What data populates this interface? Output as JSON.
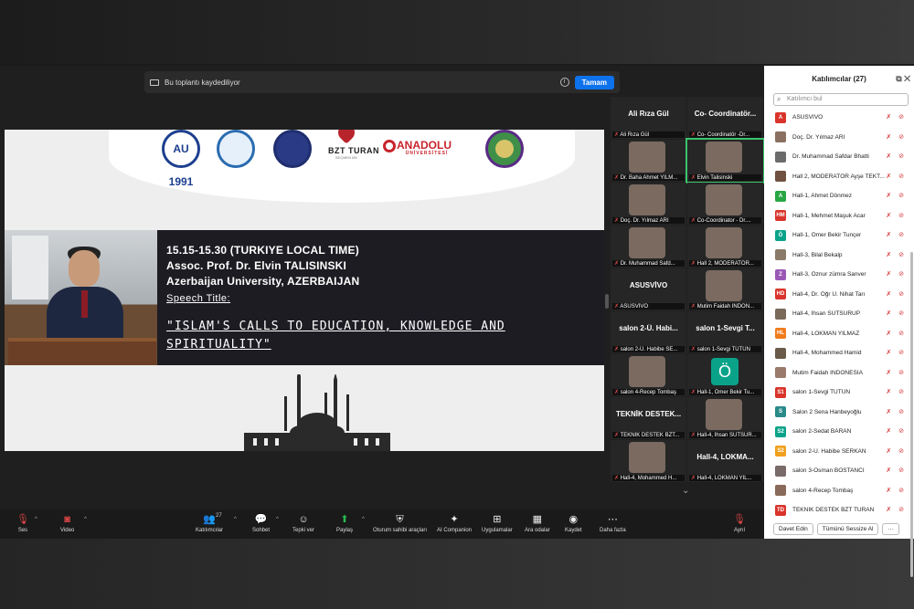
{
  "recording_bar": {
    "text": "Bu toplantı kaydediliyor",
    "ok_label": "Tamam"
  },
  "slide": {
    "logos": [
      "AU",
      "BARTIN ÜNİVERSİTESİ",
      "",
      "BZT TURAN",
      "ANADOLU ÜNİVERSİTESİ",
      ""
    ],
    "logo_ttext": {
      "au": "AU 1991",
      "bzt": "BZT TURAN",
      "bzt_sub": "SEÇMEN MV",
      "anadolu": "ANADOLU",
      "anadolu_sub": "ÜNİVERSİTESİ"
    },
    "time": "15.15-15.30 (TURKIYE LOCAL TIME)",
    "speaker": "Assoc. Prof. Dr. Elvin TALISINSKI",
    "affiliation": "Azerbaijan University, AZERBAIJAN",
    "speech_label": "Speech Title:",
    "speech_title_1": "\"ISLAM'S CALLS TO EDUCATION, KNOWLEDGE AND",
    "speech_title_2": "SPIRITUALITY\""
  },
  "grid": {
    "tiles": [
      {
        "name": "Ali Rıza Gül",
        "label": "Ali Rıza Gül",
        "kind": "name"
      },
      {
        "name": "Co- Coordinatör...",
        "label": "Co- Coordinatör -Dr...",
        "kind": "name"
      },
      {
        "name": "",
        "label": "Dr. Baha Ahmet YILM...",
        "kind": "pic"
      },
      {
        "name": "",
        "label": "Elvin Talisinski",
        "kind": "pic",
        "active": true
      },
      {
        "name": "",
        "label": "Doç. Dr. Yılmaz ARI",
        "kind": "pic"
      },
      {
        "name": "",
        "label": "Co-Coordinator - Dr....",
        "kind": "pic"
      },
      {
        "name": "",
        "label": "Dr. Muhammad Safd...",
        "kind": "pic"
      },
      {
        "name": "",
        "label": "Hall 2, MODERATÖR...",
        "kind": "pic"
      },
      {
        "name": "ASUSVİVO",
        "label": "ASUSVİVO",
        "kind": "name"
      },
      {
        "name": "",
        "label": "Mutim Faidah INDON...",
        "kind": "pic"
      },
      {
        "name": "salon 2-Ü. Habi...",
        "label": "salon 2-Ü. Habibe SE...",
        "kind": "name"
      },
      {
        "name": "salon 1-Sevgi T...",
        "label": "salon 1-Sevgi TÜTÜN",
        "kind": "name"
      },
      {
        "name": "",
        "label": "salon 4-Recep Tombaş",
        "kind": "pic"
      },
      {
        "name": "",
        "label": "Hall-1, Ömer Bekir Tu...",
        "kind": "avatar",
        "letter": "Ö"
      },
      {
        "name": "TEKNİK DESTEK...",
        "label": "TEKNİK DESTEK BZT...",
        "kind": "name"
      },
      {
        "name": "",
        "label": "Hall-4, İhsan SUTSUR...",
        "kind": "pic"
      },
      {
        "name": "",
        "label": "Hall-4, Mohammed H...",
        "kind": "pic"
      },
      {
        "name": "Hall-4, LOKMA...",
        "label": "Hall-4, LOKMAN YIL...",
        "kind": "name"
      }
    ]
  },
  "participants": {
    "title": "Katılımcılar (27)",
    "search_placeholder": "Katılımcı bul",
    "list": [
      {
        "initials": "A",
        "color": "#d9342b",
        "name": "ASUSVİVO"
      },
      {
        "initials": "",
        "color": "#8a7060",
        "name": "Doç. Dr. Yılmaz ARI"
      },
      {
        "initials": "",
        "color": "#6b6b6b",
        "name": "Dr. Muhammad Safdar Bhatti"
      },
      {
        "initials": "",
        "color": "#705040",
        "name": "Hall 2, MODERATÖR Ayşe TEKT..."
      },
      {
        "initials": "A",
        "color": "#28a745",
        "name": "Hall-1, Ahmet Dönmez"
      },
      {
        "initials": "HM",
        "color": "#d9342b",
        "name": "Hall-1, Mehmet Maşuk Acar"
      },
      {
        "initials": "Ö",
        "color": "#0aa38a",
        "name": "Hall-1, Ömer Bekir Tunçer"
      },
      {
        "initials": "",
        "color": "#8a7a6a",
        "name": "Hall-3, Bilal Bekalp"
      },
      {
        "initials": "Z",
        "color": "#9b59b6",
        "name": "Hall-3, Öznur zümra Sanver"
      },
      {
        "initials": "HD",
        "color": "#d9342b",
        "name": "Hall-4, Dr. Öğr Ü. Nihat Tarı"
      },
      {
        "initials": "",
        "color": "#7a6a5a",
        "name": "Hall-4, İhsan SUTSURUP"
      },
      {
        "initials": "HL",
        "color": "#f07b1c",
        "name": "Hall-4, LOKMAN YILMAZ"
      },
      {
        "initials": "",
        "color": "#6a5a4a",
        "name": "Hall-4, Mohammed Hamid"
      },
      {
        "initials": "",
        "color": "#9a7a6a",
        "name": "Mutim Faidah INDONESIA"
      },
      {
        "initials": "S1",
        "color": "#d9342b",
        "name": "salon 1-Sevgi TÜTÜN"
      },
      {
        "initials": "S",
        "color": "#2a8a8a",
        "name": "Salon 2 Sena Hanbeyoğlu"
      },
      {
        "initials": "S2",
        "color": "#0aa38a",
        "name": "salon 2-Sedat BARAN"
      },
      {
        "initials": "S2",
        "color": "#f0a01c",
        "name": "salon 2-Ü. Habibe SERKAN"
      },
      {
        "initials": "",
        "color": "#7a6a6a",
        "name": "salon 3-Osman BOSTANCI"
      },
      {
        "initials": "",
        "color": "#8a6a5a",
        "name": "salon 4-Recep Tombaş"
      },
      {
        "initials": "TD",
        "color": "#d9342b",
        "name": "TEKNİK DESTEK BZT TURAN"
      }
    ],
    "invite_label": "Davet Edin",
    "mute_all_label": "Tümünü Sessize Al",
    "more_label": "···"
  },
  "toolbar": {
    "audio": "Ses",
    "video": "Video",
    "participants": "Katılımcılar",
    "participants_count": "27",
    "chat": "Sohbet",
    "react": "Tepki ver",
    "share": "Paylaş",
    "host_tools": "Oturum sahibi araçları",
    "ai": "AI Companion",
    "apps": "Uygulamalar",
    "rooms": "Ara odalar",
    "record": "Kaydet",
    "more": "Daha fazla",
    "leave": "Ayrıl"
  }
}
